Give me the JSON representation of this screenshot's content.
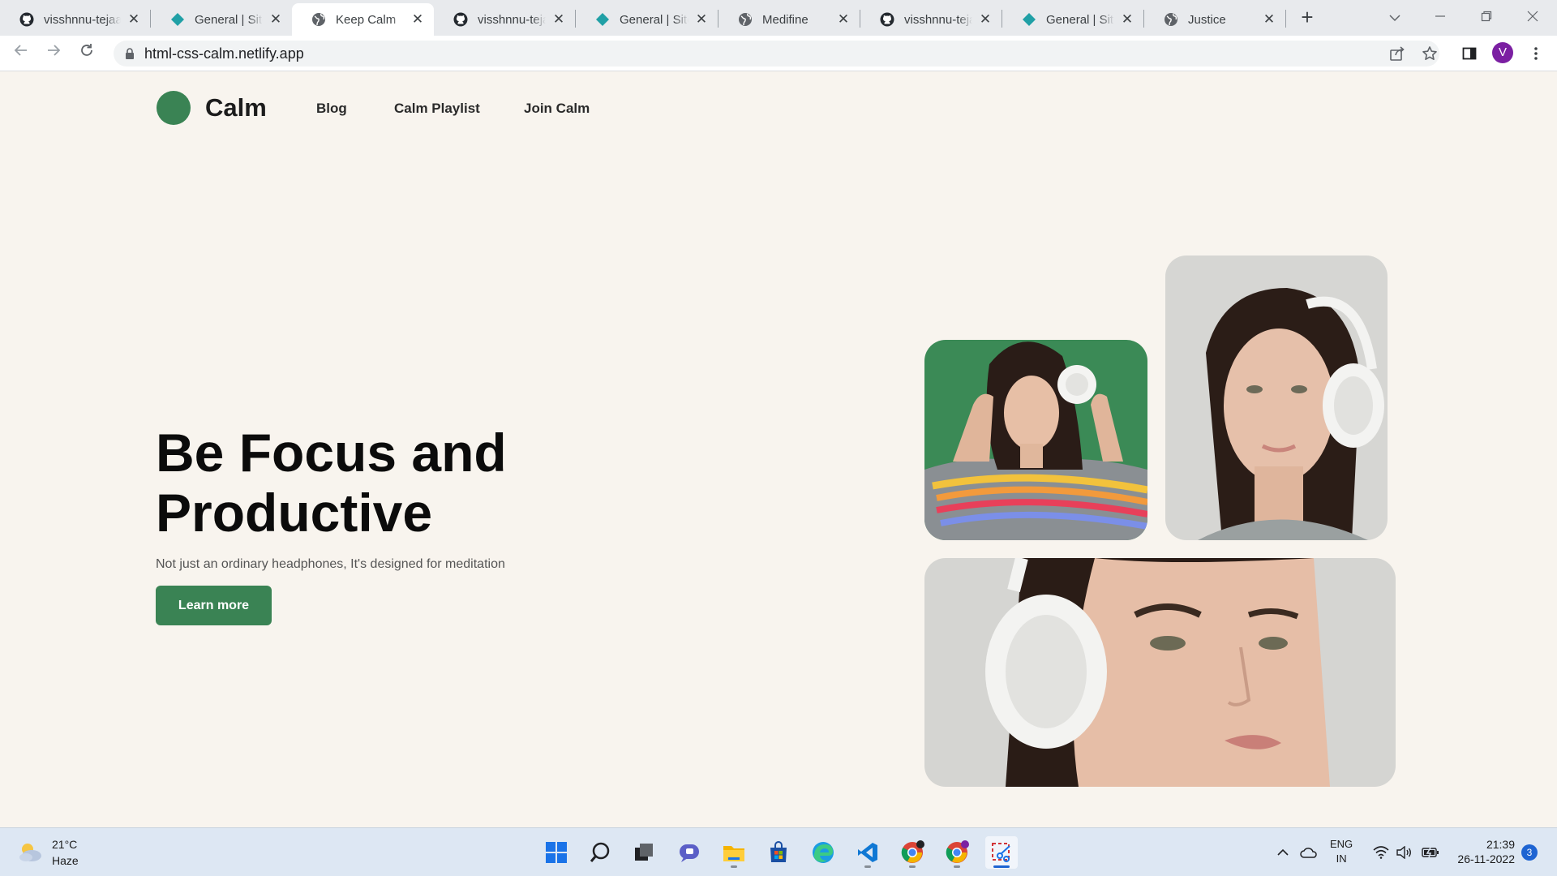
{
  "browser": {
    "tabs": [
      {
        "title": "visshnnu-tejaa",
        "icon": "github-icon"
      },
      {
        "title": "General | Site settings",
        "icon": "netlify-icon"
      },
      {
        "title": "Keep Calm",
        "icon": "globe-icon",
        "active": true
      },
      {
        "title": "visshnnu-tejaa",
        "icon": "github-icon"
      },
      {
        "title": "General | Site settings",
        "icon": "netlify-icon"
      },
      {
        "title": "Medifine",
        "icon": "globe-icon"
      },
      {
        "title": "visshnnu-tejaa",
        "icon": "github-icon"
      },
      {
        "title": "General | Site settings",
        "icon": "netlify-icon"
      },
      {
        "title": "Justice",
        "icon": "globe-icon"
      }
    ],
    "tab_close_glyph": "✕",
    "new_tab_glyph": "+",
    "url": "html-css-calm.netlify.app",
    "profile_initial": "V"
  },
  "site": {
    "logo_text": "Calm",
    "nav": [
      "Blog",
      "Calm Playlist",
      "Join Calm"
    ],
    "hero_title_line1": "Be Focus and",
    "hero_title_line2": "Productive",
    "hero_subtitle": "Not just an ordinary headphones, It's designed for meditation",
    "cta_label": "Learn more",
    "colors": {
      "brand_green": "#3a8354",
      "background": "#f8f4ee"
    }
  },
  "taskbar": {
    "weather_temp": "21°C",
    "weather_desc": "Haze",
    "lang_line1": "ENG",
    "lang_line2": "IN",
    "time": "21:39",
    "date": "26-11-2022",
    "notification_count": "3"
  }
}
